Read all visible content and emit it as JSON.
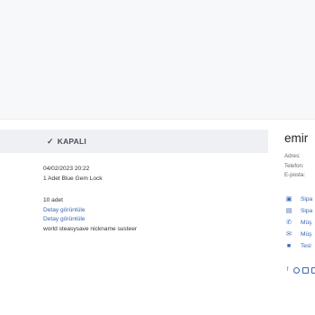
{
  "order": {
    "status": "KAPALI",
    "date": "04/02/2023 20:22",
    "item": "1 Adet Blue Gem Lock",
    "quantity": "10 adet",
    "detail_link_1": "Detay görüntüle",
    "detail_link_2": "Detay görüntüle",
    "note": "world steasysave nickname susteer"
  },
  "profile": {
    "name": "emir",
    "address_label": "Adres:",
    "phone_label": "Telefon:",
    "email_label": "E-posta:"
  },
  "menu": [
    {
      "icon": "inbox-icon",
      "label": "Sipa"
    },
    {
      "icon": "document-icon",
      "label": "Sipa"
    },
    {
      "icon": "whatsapp-icon",
      "label": "Müş"
    },
    {
      "icon": "message-icon",
      "label": "Müş"
    },
    {
      "icon": "truck-icon",
      "label": "Tesl"
    }
  ],
  "social_icons": [
    "facebook-icon",
    "twitter-icon",
    "instagram-icon",
    "youtube-icon",
    "pinterest-icon"
  ],
  "colors": {
    "link": "#3a66b3",
    "status_bar": "#eef0f3",
    "top_band": "#f7f8fa"
  }
}
